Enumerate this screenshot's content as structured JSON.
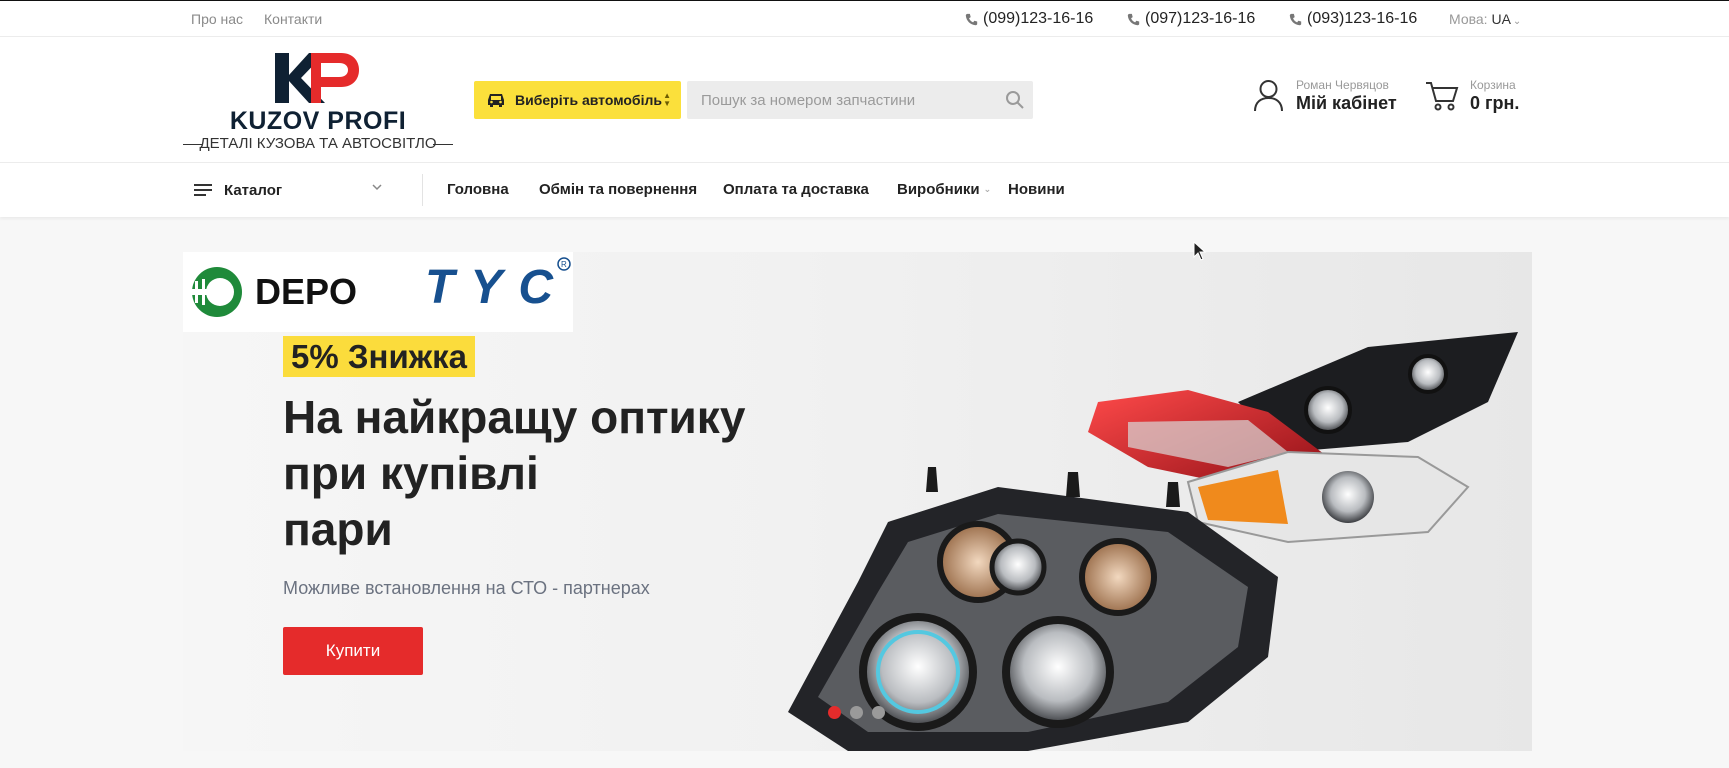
{
  "topbar": {
    "links": [
      "Про нас",
      "Контакти"
    ],
    "phones": [
      "(099)123-16-16",
      "(097)123-16-16",
      "(093)123-16-16"
    ],
    "language_label": "Мова:",
    "language_value": "UA",
    "icons": {
      "phone": "phone-icon",
      "language": "chevron-down-icon"
    }
  },
  "header": {
    "logo_title": "KUZOV PROFI",
    "logo_subtitle": "ДЕТАЛІ КУЗОВА ТА АВТОСВІТЛО",
    "logo_mark": "KP",
    "car_select_label": "Виберіть автомобіль",
    "search_placeholder": "Пошук за номером запчастини",
    "search_value": "",
    "account_user": "Роман Червяцов",
    "account_label": "Мій кабінет",
    "cart_label": "Корзина",
    "cart_total": "0 грн.",
    "icons": {
      "car": "car-icon",
      "search": "search-icon",
      "account": "user-icon",
      "cart": "cart-icon"
    }
  },
  "nav": {
    "catalog_label": "Каталог",
    "items": [
      "Головна",
      "Обмін та повернення",
      "Оплата та доставка",
      "Виробники",
      "Новини"
    ],
    "icons": {
      "catalog": "menu-icon",
      "dropdown": "chevron-down-icon"
    }
  },
  "banner": {
    "brands": [
      "DEPO",
      "TYC"
    ],
    "badge": "5% Знижка",
    "headline_lines": [
      "На найкращу оптику",
      "при купівлі",
      "пари"
    ],
    "subline": "Можливе встановлення на СТО - партнерах",
    "button_label": "Купити",
    "slides_count": 3,
    "active_slide": 1
  },
  "colors": {
    "accent_yellow": "#fbe03b",
    "accent_red": "#e52b2b",
    "text_dark": "#222222",
    "muted": "#999999",
    "logo_navy": "#0f2133"
  }
}
